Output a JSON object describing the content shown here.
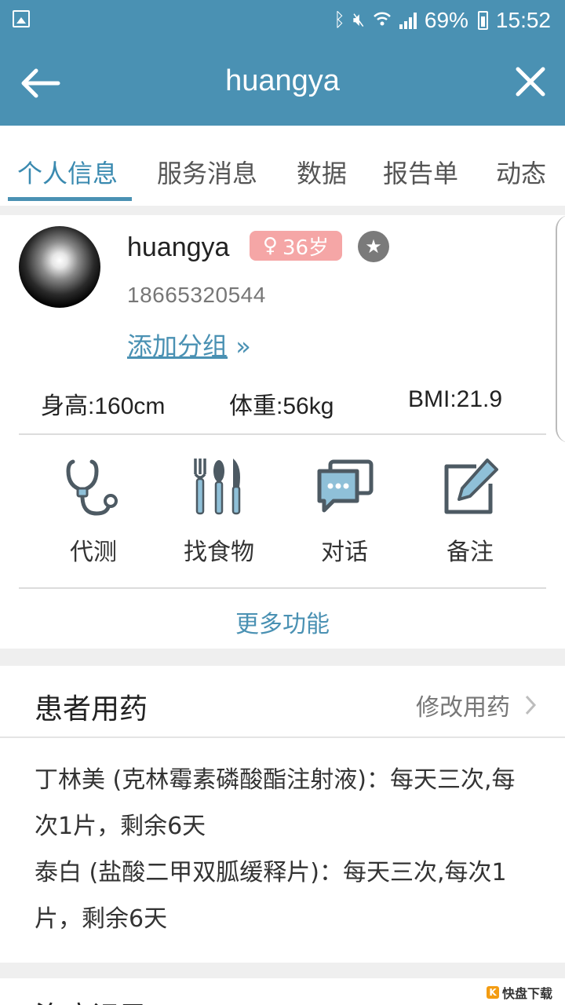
{
  "status_bar": {
    "battery": "69%",
    "time": "15:52",
    "icons": [
      "gallery-icon",
      "bluetooth-icon",
      "mute-icon",
      "wifi-icon",
      "signal-icon",
      "battery-icon"
    ]
  },
  "app_bar": {
    "title": "huangya",
    "back_icon": "back-arrow-icon",
    "close_icon": "close-icon"
  },
  "tabs": [
    {
      "label": "个人信息",
      "active": true
    },
    {
      "label": "服务消息",
      "active": false
    },
    {
      "label": "数据",
      "active": false
    },
    {
      "label": "报告单",
      "active": false
    },
    {
      "label": "动态",
      "active": false
    }
  ],
  "profile": {
    "name": "huangya",
    "gender_symbol": "♀",
    "age": "36岁",
    "phone": "18665320544",
    "add_group": "添加分组",
    "add_group_arrow": "»",
    "height": "身高:160cm",
    "weight": "体重:56kg",
    "bmi": "BMI:21.9"
  },
  "functions": [
    {
      "label": "代测",
      "icon": "stethoscope-icon"
    },
    {
      "label": "找食物",
      "icon": "cutlery-icon"
    },
    {
      "label": "对话",
      "icon": "chat-icon"
    },
    {
      "label": "备注",
      "icon": "edit-note-icon"
    }
  ],
  "more_functions": "更多功能",
  "medication": {
    "title": "患者用药",
    "edit_label": "修改用药",
    "items": [
      "丁林美 (克林霉素磷酸酯注射液)：每天三次,每次1片，剩余6天",
      "泰白 (盐酸二甲双胍缓释片)：每天三次,每次1片，剩余6天"
    ]
  },
  "next_section": {
    "title": "治疗记录"
  },
  "watermark": "快盘下载",
  "colors": {
    "primary": "#4a91b3",
    "badge": "#f5a6a6",
    "icon_blue": "#8fc0d8",
    "icon_dark": "#4d5a63"
  }
}
